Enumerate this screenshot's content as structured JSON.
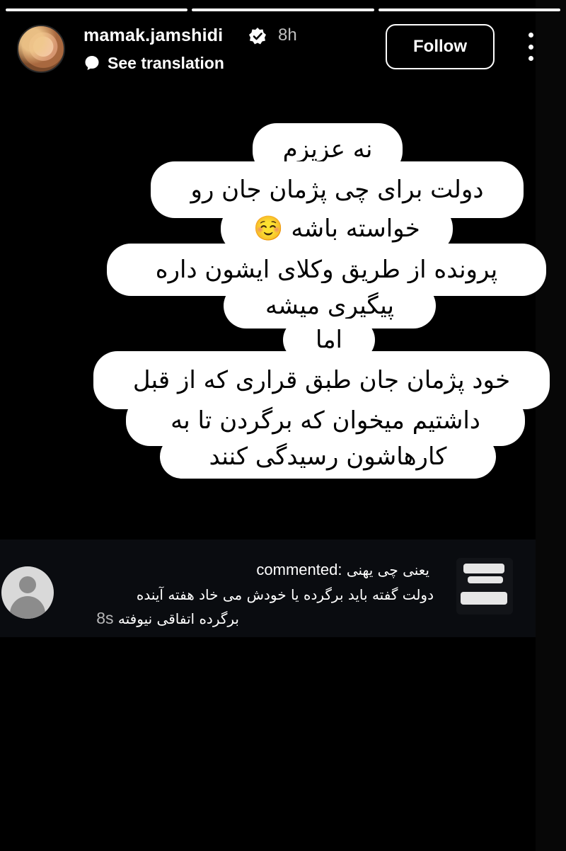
{
  "progress": {
    "segments": [
      {
        "fill": 1.0
      },
      {
        "fill": 1.0
      },
      {
        "fill": 1.0
      }
    ]
  },
  "header": {
    "username": "mamak.jamshidi",
    "time_ago": "8h",
    "see_translation": "See translation",
    "follow_label": "Follow"
  },
  "story": {
    "lines": [
      "نه عزیزم",
      "دولت برای چی پژمان جان رو",
      "خواسته باشه ☺️",
      "پرونده از طریق وکلای ایشون داره",
      "پیگیری میشه",
      "اما",
      "خود پژمان جان طبق قراری که از قبل",
      "داشتیم میخوان که برگردن تا به",
      "کارهاشون رسیدگی کنند"
    ]
  },
  "comment": {
    "header_text": "یعنی چی یهنی",
    "commented_label": "commented:",
    "line2": "دولت گفته باید برگرده  یا خودش می خاد هفته آینده",
    "line3": "برگرده اتفاقی نیوفته",
    "time": "8s"
  },
  "colors": {
    "background": "#000000",
    "bubble": "#ffffff",
    "comment_panel": "#0a0c10",
    "verified": "#ffffff"
  }
}
